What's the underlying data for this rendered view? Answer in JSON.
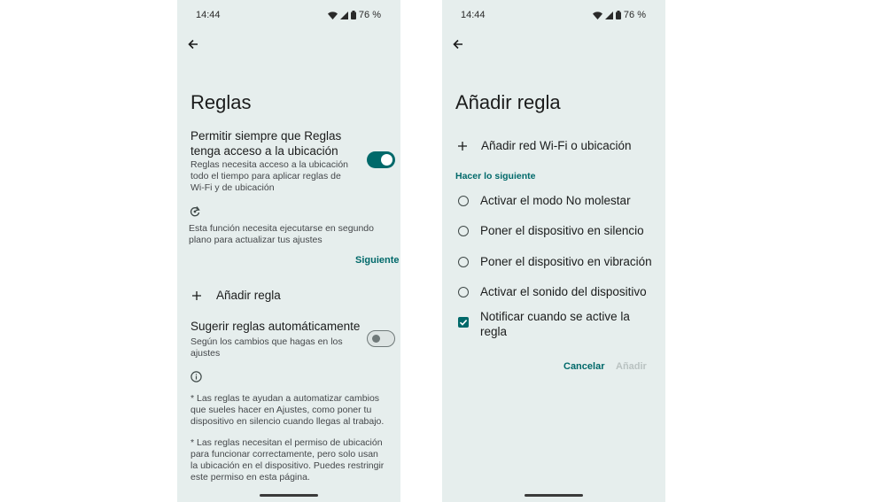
{
  "colors": {
    "accent": "#00696a",
    "screen_bg": "#e6eeed",
    "disabled": "#b9c2c1"
  },
  "status_bar": {
    "time": "14:44",
    "battery": "76 %"
  },
  "left": {
    "title": "Reglas",
    "location_pref": {
      "title": "Permitir siempre que Reglas tenga acceso a la ubicación",
      "summary": "Reglas necesita acceso a la ubicación todo el tiempo para aplicar reglas de Wi-Fi y de ubicación",
      "enabled": true
    },
    "background_notice": "Esta función necesita ejecutarse en segundo plano para actualizar tus ajustes",
    "next_button": "Siguiente",
    "add_rule": "Añadir regla",
    "suggest_pref": {
      "title": "Sugerir reglas automáticamente",
      "summary": "Según los cambios que hagas en los ajustes",
      "enabled": false
    },
    "footer": [
      "* Las reglas te ayudan a automatizar cambios que sueles hacer en Ajustes, como poner tu dispositivo en silencio cuando llegas al trabajo.",
      "* Las reglas necesitan el permiso de ubicación para funcionar correctamente, pero solo usan la ubicación en el dispositivo. Puedes restringir este permiso en esta página."
    ]
  },
  "right": {
    "title": "Añadir regla",
    "add_trigger": "Añadir red Wi-Fi o ubicación",
    "section_header": "Hacer lo siguiente",
    "actions": [
      "Activar el modo No molestar",
      "Poner el dispositivo en silencio",
      "Poner el dispositivo en vibración",
      "Activar el sonido del dispositivo"
    ],
    "notify": {
      "label": "Notificar cuando se active la regla",
      "checked": true
    },
    "cancel": "Cancelar",
    "add": "Añadir"
  },
  "icons": [
    "wifi-icon",
    "signal-icon",
    "battery-icon",
    "back-arrow-icon",
    "background-sync-icon",
    "plus-icon",
    "info-icon",
    "checkmark-icon"
  ]
}
